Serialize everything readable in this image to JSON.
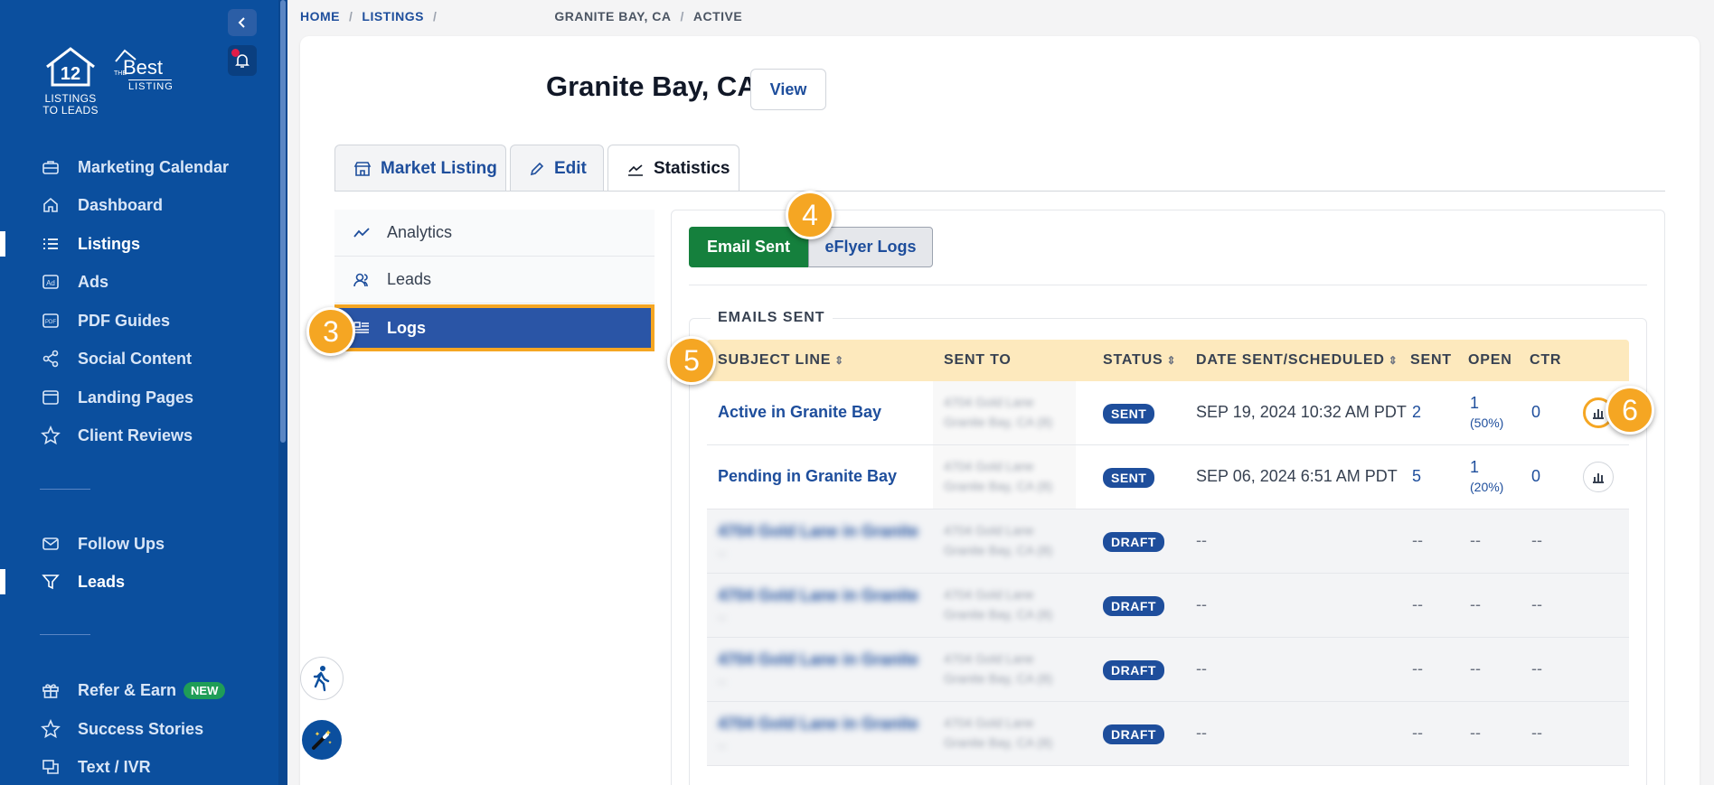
{
  "sidebar": {
    "logo1_lines": [
      "LISTINGS",
      "TO LEADS"
    ],
    "logo1_number": "12",
    "logo2": {
      "the": "THE",
      "best": "Best",
      "listing": "LISTING"
    },
    "items": [
      {
        "label": "Marketing Calendar",
        "icon": "briefcase-icon"
      },
      {
        "label": "Dashboard",
        "icon": "home-icon"
      },
      {
        "label": "Listings",
        "icon": "list-icon",
        "active": true
      },
      {
        "label": "Ads",
        "icon": "ad-icon"
      },
      {
        "label": "PDF Guides",
        "icon": "pdf-icon"
      },
      {
        "label": "Social Content",
        "icon": "share-icon"
      },
      {
        "label": "Landing Pages",
        "icon": "window-icon"
      },
      {
        "label": "Client Reviews",
        "icon": "star-icon"
      }
    ],
    "items2": [
      {
        "label": "Follow Ups",
        "icon": "mail-icon"
      },
      {
        "label": "Leads",
        "icon": "filter-icon",
        "active": true
      }
    ],
    "items3": [
      {
        "label": "Refer & Earn",
        "icon": "gift-icon",
        "badge": "NEW"
      },
      {
        "label": "Success Stories",
        "icon": "star-icon"
      },
      {
        "label": "Text / IVR",
        "icon": "chat-icon"
      }
    ]
  },
  "breadcrumb": {
    "home": "HOME",
    "listings": "LISTINGS",
    "city": "GRANITE BAY, CA",
    "status": "ACTIVE"
  },
  "page": {
    "title": "Granite Bay, CA",
    "view_label": "View"
  },
  "tabs": [
    {
      "label": "Market Listing",
      "icon": "store-icon"
    },
    {
      "label": "Edit",
      "icon": "pencil-icon"
    },
    {
      "label": "Statistics",
      "icon": "chart-line-icon",
      "active": true
    }
  ],
  "subnav": [
    {
      "label": "Analytics",
      "icon": "trend-icon"
    },
    {
      "label": "Leads",
      "icon": "users-icon"
    },
    {
      "label": "Logs",
      "icon": "log-icon",
      "active": true
    }
  ],
  "buttons": {
    "email_sent": "Email Sent",
    "eflyer_logs": "eFlyer Logs"
  },
  "section_title": "EMAILS SENT",
  "table": {
    "headers": {
      "subject": "SUBJECT LINE",
      "sent_to": "SENT TO",
      "status": "STATUS",
      "date": "DATE SENT/SCHEDULED",
      "sent": "SENT",
      "open": "OPEN",
      "ctr": "CTR"
    },
    "rows": [
      {
        "subject": "Active in Granite Bay",
        "sent_to_1": "4704 Gold Lane",
        "sent_to_2": "Granite Bay, CA (8)",
        "status": "SENT",
        "date": "SEP 19, 2024 10:32 AM PDT",
        "sent": "2",
        "open": "1",
        "open_pct": "(50%)",
        "ctr": "0"
      },
      {
        "subject": "Pending in Granite Bay",
        "sent_to_1": "4704 Gold Lane",
        "sent_to_2": "Granite Bay, CA (8)",
        "status": "SENT",
        "date": "SEP 06, 2024 6:51 AM PDT",
        "sent": "5",
        "open": "1",
        "open_pct": "(20%)",
        "ctr": "0"
      },
      {
        "subject": "4704 Gold Lane in Granite",
        "subject_2": "--",
        "sent_to_1": "4704 Gold Lane",
        "sent_to_2": "Granite Bay, CA (8)",
        "status": "DRAFT",
        "date": "--",
        "sent": "--",
        "open": "--",
        "ctr": "--"
      },
      {
        "subject": "4704 Gold Lane in Granite",
        "subject_2": "--",
        "sent_to_1": "4704 Gold Lane",
        "sent_to_2": "Granite Bay, CA (8)",
        "status": "DRAFT",
        "date": "--",
        "sent": "--",
        "open": "--",
        "ctr": "--"
      },
      {
        "subject": "4704 Gold Lane in Granite",
        "subject_2": "--",
        "sent_to_1": "4704 Gold Lane",
        "sent_to_2": "Granite Bay, CA (8)",
        "status": "DRAFT",
        "date": "--",
        "sent": "--",
        "open": "--",
        "ctr": "--"
      },
      {
        "subject": "4704 Gold Lane in Granite",
        "subject_2": "--",
        "sent_to_1": "4704 Gold Lane",
        "sent_to_2": "Granite Bay, CA (8)",
        "status": "DRAFT",
        "date": "--",
        "sent": "--",
        "open": "--",
        "ctr": "--"
      }
    ]
  },
  "steps": [
    "3",
    "4",
    "5",
    "6"
  ],
  "colors": {
    "sidebar": "#0b4f9e",
    "accent_blue": "#1e4e9c",
    "green": "#15803d",
    "highlight": "#f5a623",
    "table_header": "#fde9bd"
  }
}
